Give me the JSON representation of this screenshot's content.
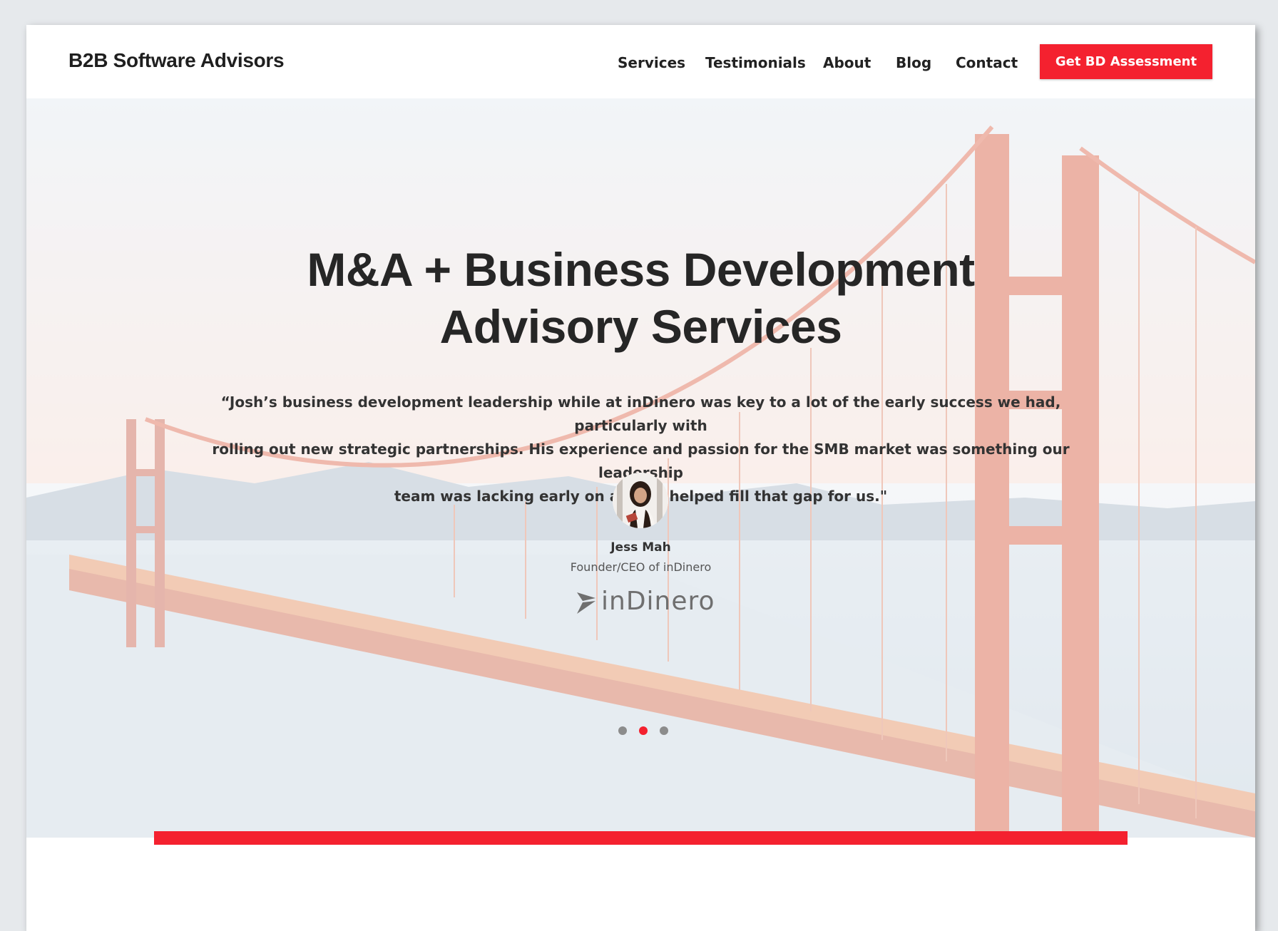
{
  "site": {
    "brand": "B2B Software Advisors",
    "nav": [
      "Services",
      "Testimonials",
      "About",
      "Blog",
      "Contact"
    ],
    "cta_label": "Get BD Assessment"
  },
  "hero": {
    "headline_line1": "M&A + Business Development",
    "headline_line2": "Advisory Services"
  },
  "testimonial": {
    "quote_line1": "“Josh’s business development leadership while at inDinero was key to a lot of the early success we had, particularly with",
    "quote_line2": "rolling out new strategic partnerships. His experience and passion for the SMB market was something our leadership",
    "quote_line3": "team was lacking early on and he helped fill that gap for us.\"",
    "name": "Jess Mah",
    "title": "Founder/CEO of inDinero",
    "company_logo_text": "inDinero"
  },
  "carousel": {
    "slide_count": 3,
    "active_index": 1
  },
  "colors": {
    "accent": "#f4212f",
    "text": "#262626"
  }
}
